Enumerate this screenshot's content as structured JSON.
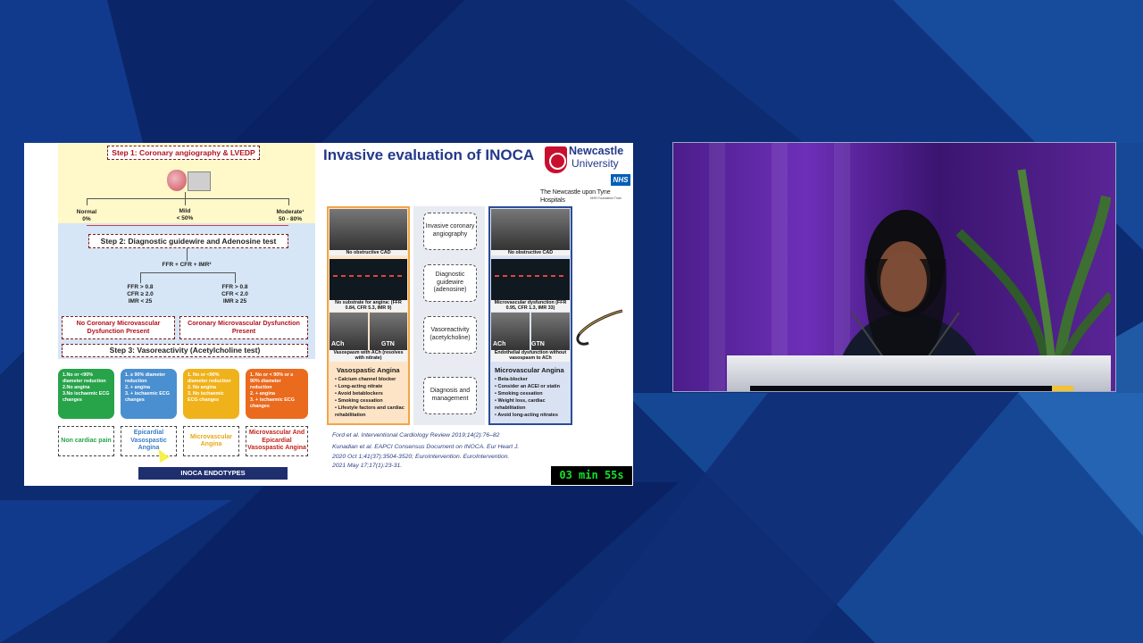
{
  "slide": {
    "flow": {
      "step1": "Step 1: Coronary angiography & LVEDP",
      "stenosis": [
        {
          "label": "Normal",
          "value": "0%"
        },
        {
          "label": "Mild",
          "value": "< 50%"
        },
        {
          "label": "Moderate¹",
          "value": "50 - 80%"
        }
      ],
      "step2": "Step 2: Diagnostic guidewire and Adenosine test",
      "metrics": "FFR + CFR + IMR³",
      "criteria_left": [
        "FFR > 0.8",
        "CFR ≥ 2.0",
        "IMR < 25"
      ],
      "criteria_right": [
        "FFR > 0.8",
        "CFR < 2.0",
        "IMR ≥ 25"
      ],
      "result_left": "No Coronary Microvascular Dysfunction Present",
      "result_right": "Coronary Microvascular Dysfunction Present",
      "step3": "Step 3: Vasoreactivity (Acetylcholine test)",
      "endotype_boxes": [
        {
          "lines": [
            "1.No or <90% diameter reduction",
            "2.No angina",
            "3.No ischaemic ECG changes"
          ],
          "color": "#27a34a"
        },
        {
          "lines": [
            "1. ≥ 90% diameter reduction",
            "2. + angina",
            "3. + ischaemic ECG changes"
          ],
          "color": "#4a8fd0"
        },
        {
          "lines": [
            "1. No or <90% diameter reduction",
            "2. No angina",
            "3. No ischaemic ECG changes"
          ],
          "color": "#f0b21a"
        },
        {
          "lines": [
            "1. No or < 90% or ≥ 90% diameter reduction",
            "2. + angina",
            "3. + ischaemic ECG changes"
          ],
          "color": "#ea6a1e"
        }
      ],
      "endotype_labels": [
        {
          "text": "Non cardiac pain",
          "color": "#27a34a"
        },
        {
          "text": "Epicardial Vasospastic Angina",
          "color": "#3a7cc8"
        },
        {
          "text": "Microvascular Angina",
          "color": "#e8a817"
        },
        {
          "text": "Microvascular And Epicardial Vasospastic Angina",
          "color": "#c2241b"
        }
      ],
      "endotypes_bar": "INOCA ENDOTYPES"
    },
    "title": "Invasive evaluation of INOCA",
    "logo": {
      "line1": "Newcastle",
      "line2": "University"
    },
    "nhs": {
      "badge": "NHS",
      "name": "The Newcastle upon Tyne Hospitals",
      "foot": "NHS Foundation Trust"
    },
    "left_col": {
      "cap1": "No obstructive CAD",
      "cap2": "No substrate for angina: (FFR 0.84, CFR 5.3, IMR 9)",
      "ach": "ACh",
      "gtn": "GTN",
      "cap3": "Vasospasm with ACh (resolves with nitrate)",
      "angina_title": "Vasospastic Angina",
      "bullets": [
        "Calcium channel blocker",
        "Long-acting nitrate",
        "Avoid betablockers",
        "Smoking cessation",
        "Lifestyle factors and cardiac rehabilitation"
      ]
    },
    "mid_col": [
      "Invasive coronary angiography",
      "Diagnostic guidewire (adenosine)",
      "Vasoreactivity (acetylcholine)",
      "Diagnosis and management"
    ],
    "right_col": {
      "cap1": "No obstructive CAD",
      "cap2": "Microvascular dysfunction (FFR 0.95, CFR 1.3, IMR 33)",
      "ach": "ACh",
      "gtn": "GTN",
      "cap3": "Endothelial dysfunction without vasospasm to ACh",
      "angina_title": "Microvascular Angina",
      "bullets": [
        "Beta-blocker",
        "Consider an ACEI or statin",
        "Smoking cessation",
        "Weight loss, cardiac rehabilitation",
        "Avoid long-acting nitrates"
      ]
    },
    "ref1": "Ford et al. Interventional Cardiology Review 2019;14(2):76–82",
    "ref2": [
      "Kunadian et al. EAPCI Consensus Document on INOCA. Eur Heart J.",
      "2020 Oct 1;41(37):3504-3520; EuroIntervention. EuroIntervention.",
      "2021 May 17;17(1):23-31."
    ],
    "timer": "03 min 55s"
  },
  "colors": {
    "background": "#0b2a6e",
    "accent_blue": "#23398a",
    "timer_green": "#16e02b"
  }
}
